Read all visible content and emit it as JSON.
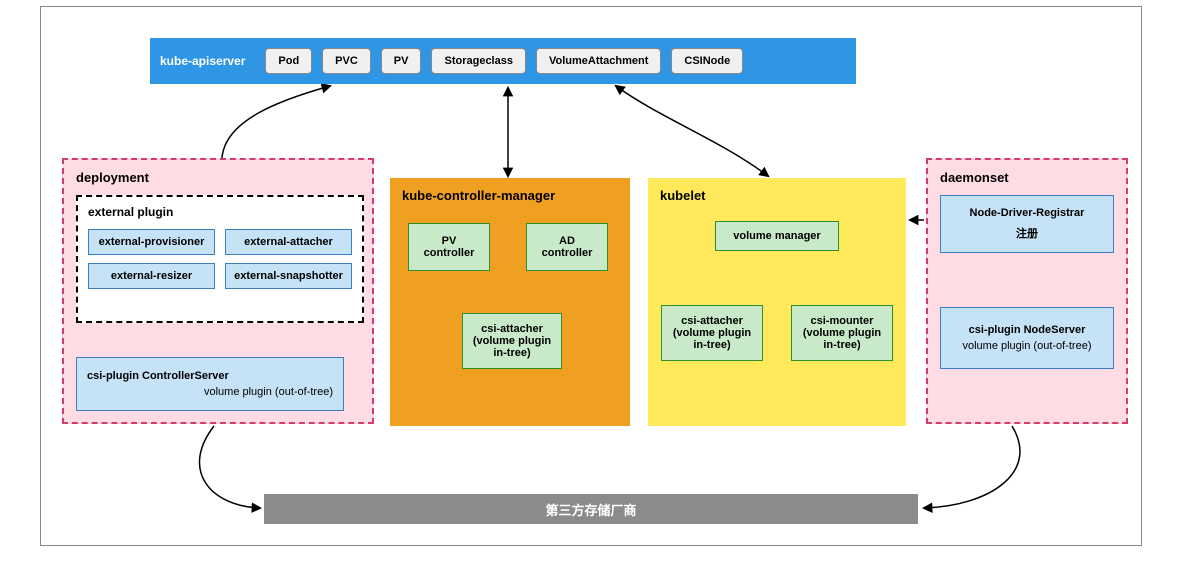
{
  "apiserver": {
    "title": "kube-apiserver",
    "resources": [
      "Pod",
      "PVC",
      "PV",
      "Storageclass",
      "VolumeAttachment",
      "CSINode"
    ]
  },
  "deployment": {
    "title": "deployment",
    "external_plugin_title": "external plugin",
    "plugins": [
      "external-provisioner",
      "external-attacher",
      "external-resizer",
      "external-snapshotter"
    ],
    "csi_plugin_title": "csi-plugin  ControllerServer",
    "csi_plugin_sub": "volume plugin (out-of-tree)"
  },
  "kcm": {
    "title": "kube-controller-manager",
    "pv": "PV\ncontroller",
    "ad": "AD\ncontroller",
    "attacher": "csi-attacher\n(volume plugin\nin-tree)"
  },
  "kubelet": {
    "title": "kubelet",
    "vm": "volume manager",
    "attacher": "csi-attacher\n(volume plugin\nin-tree)",
    "mounter": "csi-mounter\n(volume plugin\nin-tree)"
  },
  "daemonset": {
    "title": "daemonset",
    "registrar": "Node-Driver-Registrar",
    "registrar_sub": "注册",
    "node_server": "csi-plugin  NodeServer",
    "node_server_sub": "volume plugin (out-of-tree)"
  },
  "third_party": "第三方存储厂商"
}
